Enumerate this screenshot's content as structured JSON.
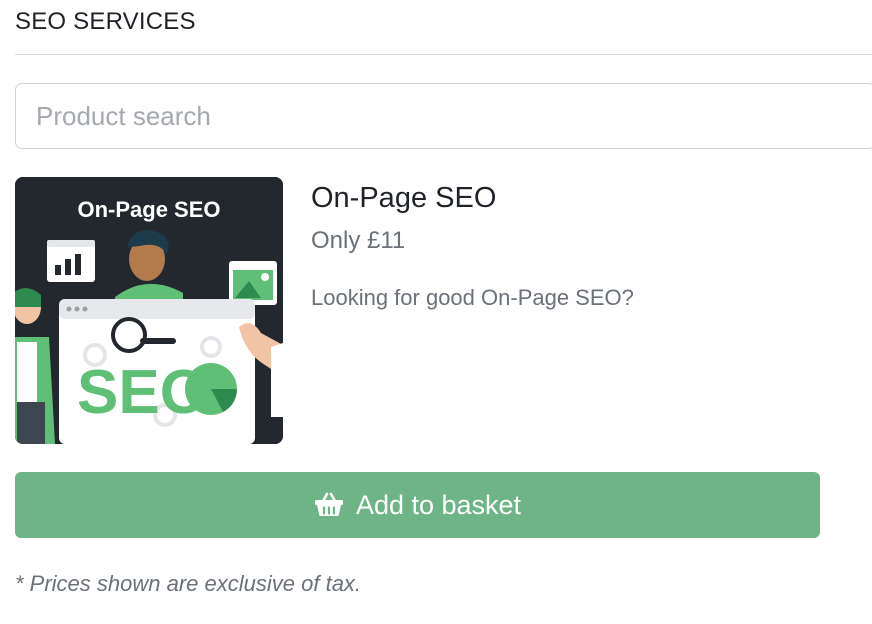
{
  "section": {
    "title": "SEO SERVICES"
  },
  "search": {
    "placeholder": "Product search",
    "value": ""
  },
  "product": {
    "image_text": "On-Page SEO",
    "image_logo_text": "SEO",
    "name": "On-Page SEO",
    "price": "Only £11",
    "description": "Looking for good On-Page SEO?"
  },
  "actions": {
    "add_to_basket_label": "Add to basket",
    "basket_icon": "basket-icon"
  },
  "footer": {
    "tax_note": "* Prices shown are exclusive of tax."
  },
  "colors": {
    "button_bg": "#6eb487",
    "image_bg": "#23272e",
    "accent_green": "#5fbf77",
    "text_dark": "#1f2328",
    "text_muted": "#6b7178"
  }
}
